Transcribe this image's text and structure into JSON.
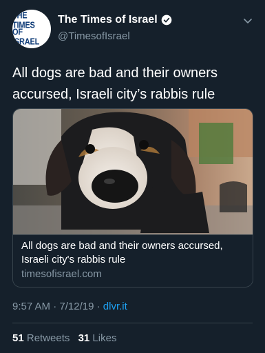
{
  "account": {
    "avatar_line1": "THE TIMES",
    "avatar_line2": "OF ISRAEL",
    "display_name": "The Times of Israel",
    "handle": "@TimesofIsrael",
    "verified_icon": "verified-badge-icon"
  },
  "tweet": {
    "text": "All dogs are bad and their owners accursed, Israeli city’s rabbis rule"
  },
  "card": {
    "image_description_icon": "dog-photo",
    "title": "All dogs are bad and their owners accursed, Israeli city's rabbis rule",
    "domain": "timesofisrael.com"
  },
  "meta": {
    "time": "9:57 AM",
    "date": "7/12/19",
    "separator": "·",
    "source": "dlvr.it"
  },
  "stats": {
    "retweets_count": "51",
    "retweets_label": "Retweets",
    "likes_count": "31",
    "likes_label": "Likes"
  },
  "colors": {
    "background": "#15202b",
    "secondary_text": "#8899a6",
    "link": "#1da1f2",
    "border": "#38444d"
  }
}
